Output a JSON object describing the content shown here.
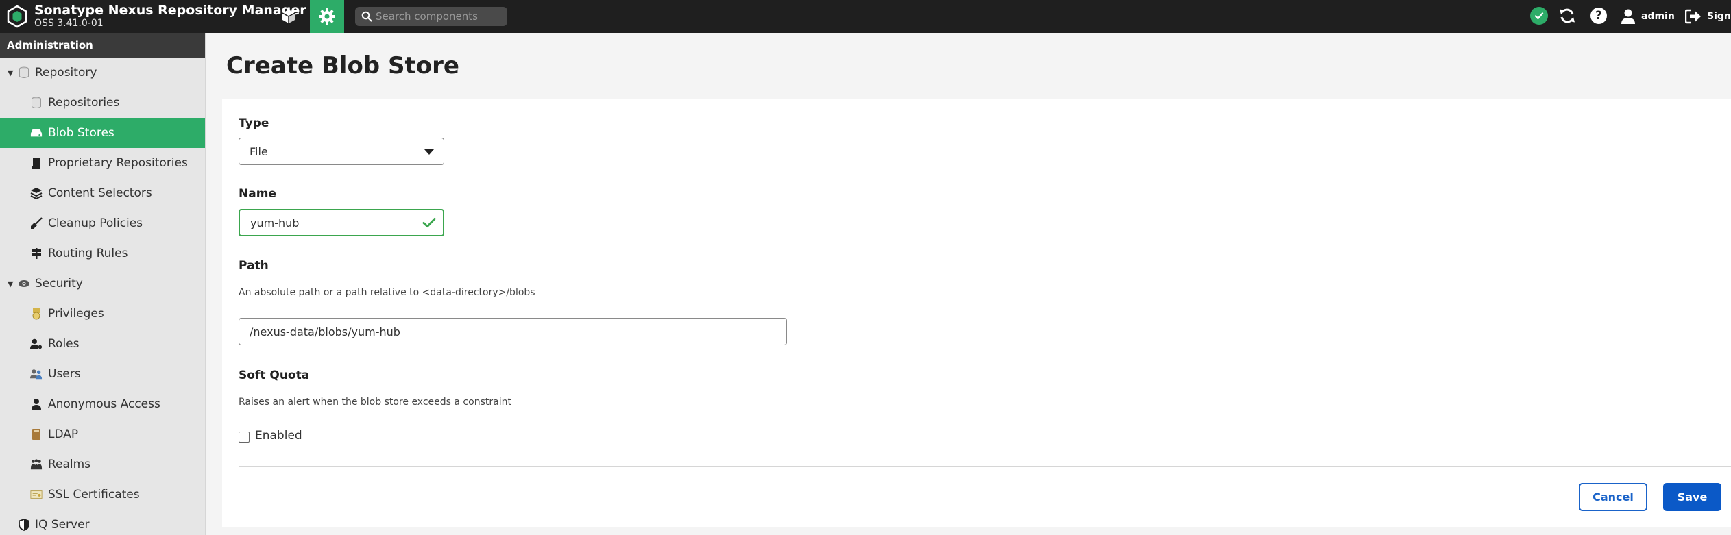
{
  "header": {
    "title": "Sonatype Nexus Repository Manager",
    "version": "OSS 3.41.0-01",
    "search_placeholder": "Search components",
    "user": "admin",
    "signout_label": "Sign out",
    "icons": [
      "nexus-logo-icon",
      "cube-icon",
      "gear-icon",
      "search-icon",
      "check-circle-icon",
      "refresh-icon",
      "help-icon",
      "user-icon",
      "sign-out-icon"
    ]
  },
  "sidebar": {
    "heading": "Administration",
    "items": [
      {
        "label": "Repository",
        "icon": "database-icon"
      },
      {
        "label": "Repositories",
        "icon": "database-icon"
      },
      {
        "label": "Blob Stores",
        "icon": "hard-drive-icon"
      },
      {
        "label": "Proprietary Repositories",
        "icon": "id-badge-icon"
      },
      {
        "label": "Content Selectors",
        "icon": "layers-icon"
      },
      {
        "label": "Cleanup Policies",
        "icon": "broom-icon"
      },
      {
        "label": "Routing Rules",
        "icon": "signpost-icon"
      },
      {
        "label": "Security",
        "icon": "eye-icon"
      },
      {
        "label": "Privileges",
        "icon": "medal-icon"
      },
      {
        "label": "Roles",
        "icon": "user-cog-icon"
      },
      {
        "label": "Users",
        "icon": "users-icon"
      },
      {
        "label": "Anonymous Access",
        "icon": "user-icon"
      },
      {
        "label": "LDAP",
        "icon": "book-icon"
      },
      {
        "label": "Realms",
        "icon": "realms-icon"
      },
      {
        "label": "SSL Certificates",
        "icon": "certificate-icon"
      },
      {
        "label": "IQ Server",
        "icon": "shield-icon"
      }
    ],
    "active": "Blob Stores"
  },
  "page": {
    "title": "Create Blob Store"
  },
  "form": {
    "type_label": "Type",
    "type_value": "File",
    "name_label": "Name",
    "name_value": "yum-hub",
    "path_label": "Path",
    "path_desc": "An absolute path or a path relative to <data-directory>/blobs",
    "path_value": "/nexus-data/blobs/yum-hub",
    "soft_quota_label": "Soft Quota",
    "soft_quota_desc": "Raises an alert when the blob store exceeds a constraint",
    "enabled_label": "Enabled",
    "enabled": false,
    "cancel_label": "Cancel",
    "save_label": "Save"
  },
  "colors": {
    "accent_green": "#2dac68",
    "primary_blue": "#0b59c7",
    "header_bg": "#1f1f1f"
  }
}
